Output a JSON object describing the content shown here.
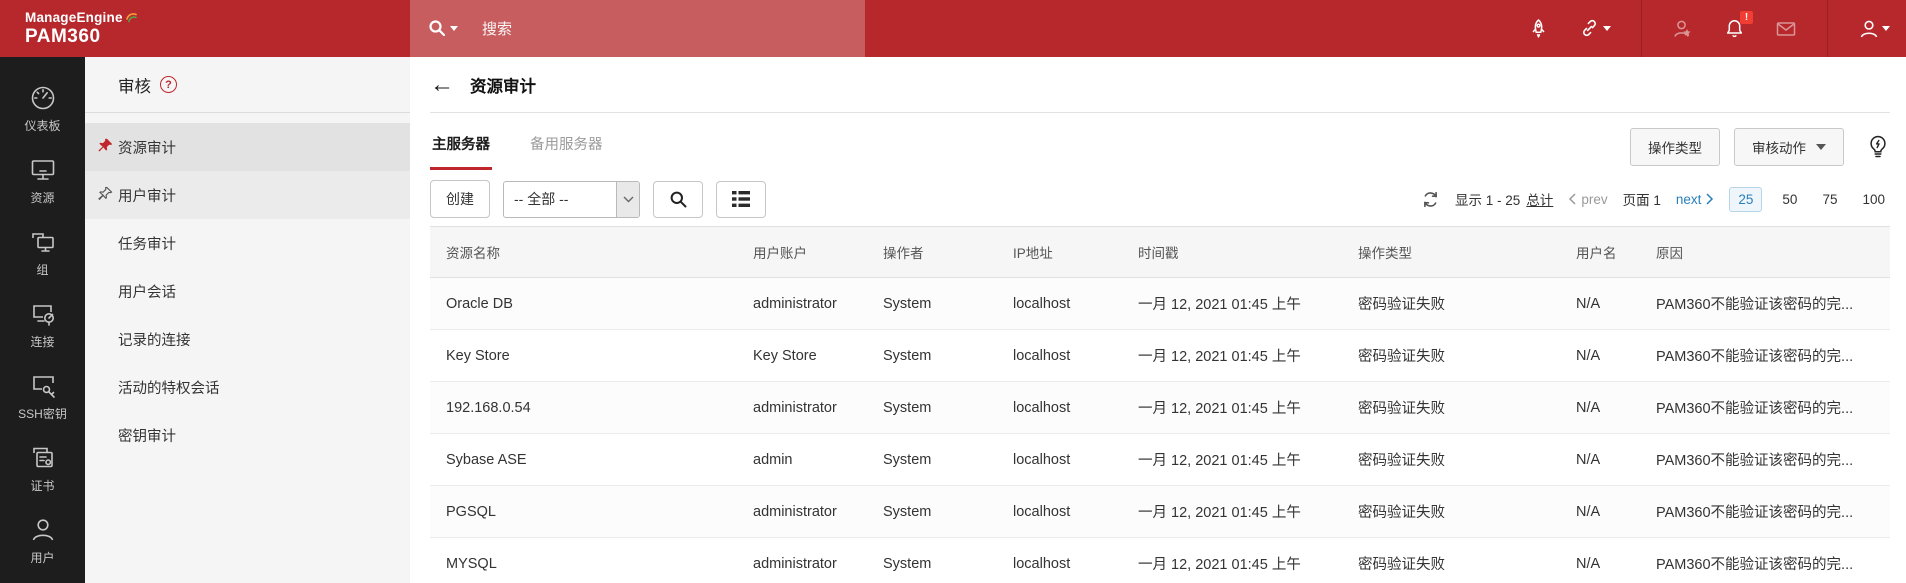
{
  "colors": {
    "topbar": "#b7282d",
    "search_band": "#c75d5f",
    "accent_red": "#c0272d",
    "link_blue": "#2980b9",
    "badge_red": "#f23d32"
  },
  "topbar": {
    "brand_line1": "ManageEngine",
    "brand_line2": "PAM360",
    "search_placeholder": "搜索",
    "notification_badge": "!"
  },
  "rail": {
    "items": [
      {
        "label": "仪表板"
      },
      {
        "label": "资源"
      },
      {
        "label": "组"
      },
      {
        "label": "连接"
      },
      {
        "label": "SSH密钥"
      },
      {
        "label": "证书"
      },
      {
        "label": "用户"
      }
    ]
  },
  "audit_menu": {
    "title": "审核",
    "help": "?",
    "items": [
      {
        "label": "资源审计"
      },
      {
        "label": "用户审计"
      },
      {
        "label": "任务审计"
      },
      {
        "label": "用户会话"
      },
      {
        "label": "记录的连接"
      },
      {
        "label": "活动的特权会话"
      },
      {
        "label": "密钥审计"
      }
    ]
  },
  "main": {
    "title": "资源审计",
    "tabs": {
      "primary": "主服务器",
      "secondary": "备用服务器"
    },
    "actions": {
      "operation_type": "操作类型",
      "audit_action": "审核动作"
    },
    "toolbar": {
      "create": "创建",
      "filter_selected": "-- 全部 --"
    },
    "pagination": {
      "summary": "显示 1 - 25",
      "total": "总计",
      "prev": "prev",
      "page": "页面 1",
      "next": "next",
      "sizes": [
        "25",
        "50",
        "75",
        "100"
      ],
      "active_size": "25"
    },
    "table": {
      "columns": [
        "资源名称",
        "用户账户",
        "操作者",
        "IP地址",
        "时间戳",
        "操作类型",
        "用户名",
        "原因"
      ],
      "rows": [
        [
          "Oracle DB",
          "administrator",
          "System",
          "localhost",
          "一月 12, 2021 01:45 上午",
          "密码验证失败",
          "N/A",
          "PAM360不能验证该密码的完..."
        ],
        [
          "Key Store",
          "Key Store",
          "System",
          "localhost",
          "一月 12, 2021 01:45 上午",
          "密码验证失败",
          "N/A",
          "PAM360不能验证该密码的完..."
        ],
        [
          "192.168.0.54",
          "administrator",
          "System",
          "localhost",
          "一月 12, 2021 01:45 上午",
          "密码验证失败",
          "N/A",
          "PAM360不能验证该密码的完..."
        ],
        [
          "Sybase ASE",
          "admin",
          "System",
          "localhost",
          "一月 12, 2021 01:45 上午",
          "密码验证失败",
          "N/A",
          "PAM360不能验证该密码的完..."
        ],
        [
          "PGSQL",
          "administrator",
          "System",
          "localhost",
          "一月 12, 2021 01:45 上午",
          "密码验证失败",
          "N/A",
          "PAM360不能验证该密码的完..."
        ],
        [
          "MYSQL",
          "administrator",
          "System",
          "localhost",
          "一月 12, 2021 01:45 上午",
          "密码验证失败",
          "N/A",
          "PAM360不能验证该密码的完..."
        ]
      ]
    }
  }
}
